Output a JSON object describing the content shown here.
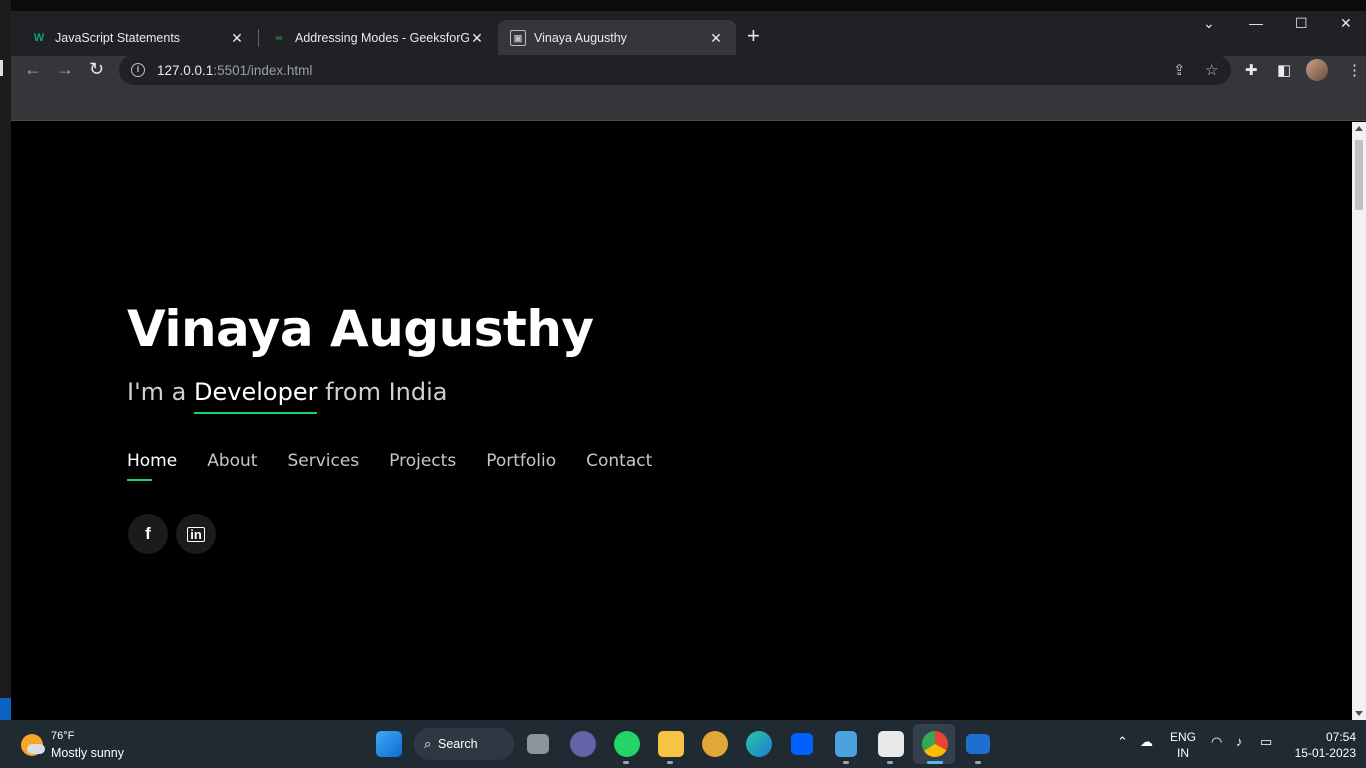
{
  "browser": {
    "tabs": [
      {
        "title": "JavaScript Statements",
        "favicon": "w3schools-icon"
      },
      {
        "title": "Addressing Modes - GeeksforGe",
        "favicon": "geeksforgeeks-icon"
      },
      {
        "title": "Vinaya Augusthy",
        "favicon": "page-icon"
      }
    ],
    "url_host": "127.0.0.1",
    "url_rest": ":5501/index.html"
  },
  "hero": {
    "name": "Vinaya Augusthy",
    "tagline_prefix": "I'm a ",
    "tagline_role": "Developer",
    "tagline_suffix": " from India"
  },
  "nav": {
    "items": [
      "Home",
      "About",
      "Services",
      "Projects",
      "Portfolio",
      "Contact"
    ],
    "active": "Home"
  },
  "social": [
    {
      "name": "facebook",
      "glyph": "f"
    },
    {
      "name": "linkedin",
      "glyph": "in"
    }
  ],
  "accent_color": "#18d26e",
  "taskbar": {
    "temperature": "76°F",
    "weather_desc": "Mostly sunny",
    "search_label": "Search",
    "lang_top": "ENG",
    "lang_bottom": "IN",
    "time": "07:54",
    "date": "15-01-2023"
  }
}
